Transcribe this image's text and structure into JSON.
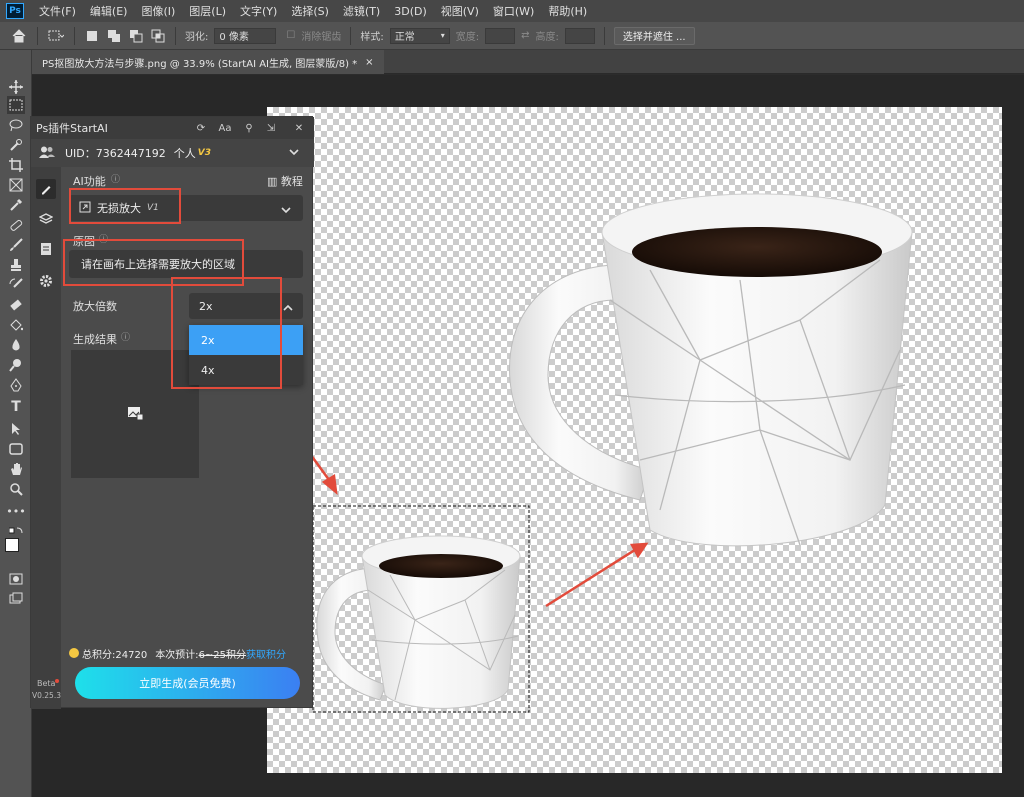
{
  "menubar": {
    "logo": "Ps",
    "items": [
      "文件(F)",
      "编辑(E)",
      "图像(I)",
      "图层(L)",
      "文字(Y)",
      "选择(S)",
      "滤镜(T)",
      "3D(D)",
      "视图(V)",
      "窗口(W)",
      "帮助(H)"
    ]
  },
  "options": {
    "feather_label": "羽化:",
    "feather_value": "0 像素",
    "antialias_label": "消除锯齿",
    "style_label": "样式:",
    "style_value": "正常",
    "width_label": "宽度:",
    "height_label": "高度:",
    "select_mask_button": "选择并遮住 ..."
  },
  "document": {
    "tab_title": "PS抠图放大方法与步骤.png @ 33.9% (StartAI AI生成, 图层蒙版/8) *",
    "close": "×"
  },
  "panel": {
    "title": "Ps插件StartAI",
    "aa_label": "Aa",
    "uid_label": "UID：7362447192",
    "account_type": "个人",
    "vip_badge": "V3",
    "ai_function_label": "AI功能",
    "tutorial_label": "教程",
    "function_value": "无损放大",
    "function_badge": "V1",
    "original_label": "原图",
    "original_hint": "请在画布上选择需要放大的区域",
    "scale_label": "放大倍数",
    "scale_value": "2x",
    "scale_options": [
      "2x",
      "4x"
    ],
    "result_label": "生成结果",
    "points_total": "总积分:24720",
    "points_estimate": "本次预计:",
    "points_range": "6~25积分",
    "get_points": "获取积分",
    "generate_button": "立即生成(会员免费)",
    "beta_label": "Beta",
    "version_label": "V0.25.3"
  },
  "colors": {
    "accent_blue": "#31a8ff",
    "highlight_red": "#e24b3b",
    "gen_gradient_start": "#1ee0ea",
    "gen_gradient_end": "#3b7ff2",
    "vip_gold": "#f5c842"
  }
}
